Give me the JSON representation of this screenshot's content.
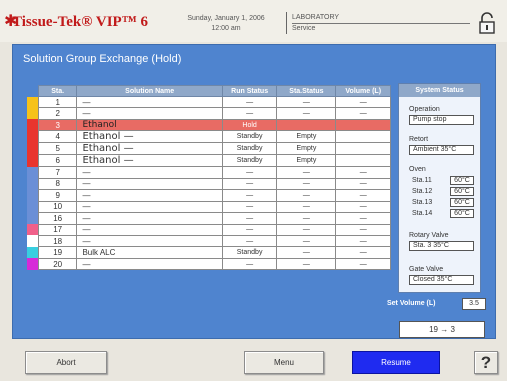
{
  "header": {
    "brand": "Tissue-Tek® VIP™ 6",
    "date": "Sunday, January 1, 2006",
    "time": "12:00 am",
    "site": "LABORATORY",
    "mode": "Service"
  },
  "panel": {
    "title": "Solution Group Exchange (Hold)"
  },
  "table": {
    "headers": [
      "Sta.",
      "Solution Name",
      "Run Status",
      "Sta.Status",
      "Volume (L)"
    ],
    "rows": [
      {
        "color": "#f6c21a",
        "sta": "1",
        "name": "—",
        "run": "—",
        "ss": "—",
        "vol": "—",
        "highlight": false
      },
      {
        "color": "#f6c21a",
        "sta": "2",
        "name": "—",
        "run": "—",
        "ss": "—",
        "vol": "—",
        "highlight": false
      },
      {
        "color": "#e9342e",
        "sta": "3",
        "name": "Ethanol",
        "run": "Hold",
        "ss": "",
        "vol": "",
        "highlight": true
      },
      {
        "color": "#e9342e",
        "sta": "4",
        "name": "Ethanol  —",
        "run": "Standby",
        "ss": "Empty",
        "vol": "",
        "highlight": false
      },
      {
        "color": "#e9342e",
        "sta": "5",
        "name": "Ethanol  —",
        "run": "Standby",
        "ss": "Empty",
        "vol": "",
        "highlight": false
      },
      {
        "color": "#e9342e",
        "sta": "6",
        "name": "Ethanol  —",
        "run": "Standby",
        "ss": "Empty",
        "vol": "",
        "highlight": false
      },
      {
        "color": "#6b8fd6",
        "sta": "7",
        "name": "—",
        "run": "—",
        "ss": "—",
        "vol": "—",
        "highlight": false
      },
      {
        "color": "#6b8fd6",
        "sta": "8",
        "name": "—",
        "run": "—",
        "ss": "—",
        "vol": "—",
        "highlight": false
      },
      {
        "color": "#6b8fd6",
        "sta": "9",
        "name": "—",
        "run": "—",
        "ss": "—",
        "vol": "—",
        "highlight": false
      },
      {
        "color": "#6b8fd6",
        "sta": "10",
        "name": "—",
        "run": "—",
        "ss": "—",
        "vol": "—",
        "highlight": false
      },
      {
        "color": "#6b8fd6",
        "sta": "16",
        "name": "—",
        "run": "—",
        "ss": "—",
        "vol": "—",
        "highlight": false
      },
      {
        "color": "#f0608a",
        "sta": "17",
        "name": "—",
        "run": "—",
        "ss": "—",
        "vol": "—",
        "highlight": false
      },
      {
        "color": "#ffffff",
        "sta": "18",
        "name": "—",
        "run": "—",
        "ss": "—",
        "vol": "—",
        "highlight": false
      },
      {
        "color": "#38cfe0",
        "sta": "19",
        "name": "Bulk  ALC",
        "run": "Standby",
        "ss": "—",
        "vol": "—",
        "highlight": false
      },
      {
        "color": "#d62ad8",
        "sta": "20",
        "name": "—",
        "run": "—",
        "ss": "—",
        "vol": "—",
        "highlight": false
      }
    ]
  },
  "system_status": {
    "title": "System Status",
    "operation_label": "Operation",
    "operation_value": "Pump stop",
    "retort_label": "Retort",
    "retort_value": "Ambient 35°C",
    "oven_label": "Oven",
    "oven": [
      {
        "label": "Sta.11",
        "value": "60°C"
      },
      {
        "label": "Sta.12",
        "value": "60°C"
      },
      {
        "label": "Sta.13",
        "value": "60°C"
      },
      {
        "label": "Sta.14",
        "value": "60°C"
      }
    ],
    "rotary_label": "Rotary Valve",
    "rotary_value": "Sta. 3 35°C",
    "gate_label": "Gate Valve",
    "gate_value": "Closed 35°C"
  },
  "set_volume": {
    "label": "Set Volume (L)",
    "value": "3.5"
  },
  "transfer": "19 → 3",
  "footer": {
    "abort": "Abort",
    "menu": "Menu",
    "resume": "Resume",
    "help": "?"
  },
  "colors": {
    "panel": "#4f84cf",
    "highlight_row": "#e86b64",
    "resume_button": "#1f2bf0",
    "brand": "#c11a1a"
  },
  "icons": {
    "lock": "lock-icon",
    "brand_star": "star-icon"
  }
}
